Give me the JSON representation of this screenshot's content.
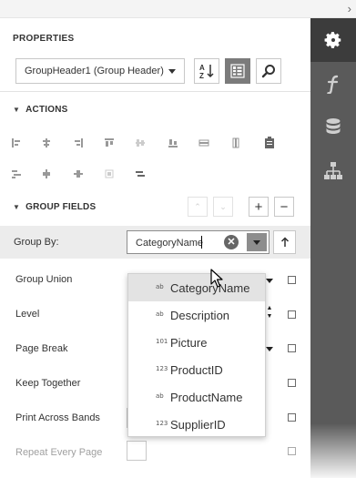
{
  "panel": {
    "title": "PROPERTIES",
    "component_selector": "GroupHeader1 (Group Header)",
    "toolbar_icons": [
      "sort-alphabetical-icon",
      "categorized-view-icon",
      "search-icon"
    ]
  },
  "rail": {
    "tabs": [
      {
        "name": "properties-gear-icon",
        "active": true
      },
      {
        "name": "expressions-function-icon",
        "active": false
      },
      {
        "name": "field-list-database-icon",
        "active": false
      },
      {
        "name": "report-explorer-tree-icon",
        "active": false
      }
    ]
  },
  "actions": {
    "section_label": "ACTIONS"
  },
  "group_fields": {
    "section_label": "GROUP FIELDS",
    "add_label": "+",
    "remove_label": "−",
    "move_up_label": "⌃",
    "move_down_label": "⌄"
  },
  "group_by": {
    "label": "Group By:",
    "value": "CategoryName",
    "clear_label": "✕",
    "sort_label": "🡑"
  },
  "properties": [
    {
      "label": "Group Union"
    },
    {
      "label": "Level"
    },
    {
      "label": "Page Break"
    },
    {
      "label": "Keep Together"
    },
    {
      "label": "Print Across Bands"
    },
    {
      "label": "Repeat Every Page"
    }
  ],
  "dropdown": {
    "items": [
      {
        "badge": "ab",
        "label": "CategoryName",
        "selected": true
      },
      {
        "badge": "ab",
        "label": "Description",
        "selected": false
      },
      {
        "badge": "101",
        "label": "Picture",
        "selected": false
      },
      {
        "badge": "123",
        "label": "ProductID",
        "selected": false
      },
      {
        "badge": "ab",
        "label": "ProductName",
        "selected": false
      },
      {
        "badge": "123",
        "label": "SupplierID",
        "selected": false
      }
    ]
  },
  "colors": {
    "rail": "#5a5a5a",
    "rail_active": "#3c3c3c",
    "selected_row": "#ececec",
    "dropdown_selected": "#e3e3e3"
  }
}
